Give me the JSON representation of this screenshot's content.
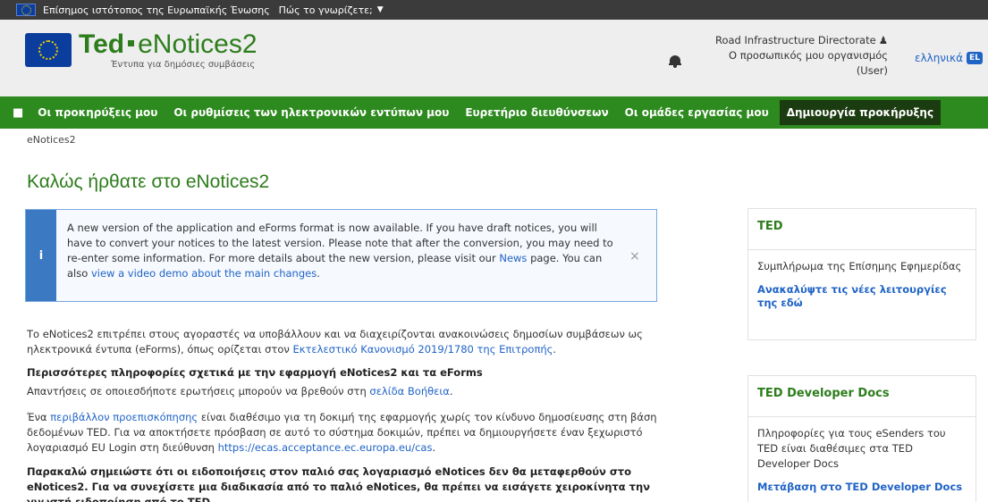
{
  "eu_bar": {
    "text": "Επίσημος ιστότοπος της Ευρωπαϊκής Ένωσης",
    "how_label": "Πώς το γνωρίζετε;"
  },
  "header": {
    "logo_ted": "Ted",
    "logo_enotices": "eNotices2",
    "logo_subtitle": "Έντυπα για δημόσιες συμβάσεις",
    "user_name": "Road Infrastructure Directorate",
    "organisation": "Ο προσωπικός μου οργανισμός",
    "role": "(User)",
    "language_label": "ελληνικά",
    "language_code": "EL"
  },
  "nav": {
    "items": [
      "Οι προκηρύξεις μου",
      "Οι ρυθμίσεις των ηλεκτρονικών εντύπων μου",
      "Ευρετήριο διευθύνσεων",
      "Οι ομάδες εργασίας μου",
      "Δημιουργία προκήρυξης"
    ]
  },
  "breadcrumb": "eNotices2",
  "page_title": "Καλώς ήρθατε στο eNotices2",
  "alert": {
    "icon": "i",
    "text_before": "A new version of the application and eForms format is now available. If you have draft notices, you will have to convert your notices to the latest version. Please note that after the conversion, you may need to re-enter some information. For more details about the new version, please visit our ",
    "news_link": "News",
    "text_middle": " page. You can also ",
    "video_link": "view a video demo about the main changes",
    "text_after": ".",
    "close": "×"
  },
  "content": {
    "p1_text": "Το eNotices2 επιτρέπει στους αγοραστές να υποβάλλουν και να διαχειρίζονται ανακοινώσεις δημοσίων συμβάσεων ως ηλεκτρονικά έντυπα (eForms), όπως ορίζεται στον ",
    "p1_link": "Εκτελεστικό Κανονισμό 2019/1780 της Επιτροπής",
    "p1_end": ".",
    "h2": "Περισσότερες πληροφορίες σχετικά με την εφαρμογή eNotices2 και τα eForms",
    "p2_text": "Απαντήσεις σε οποιεσδήποτε ερωτήσεις μπορούν να βρεθούν στη ",
    "p2_link": "σελίδα Βοήθεια",
    "p2_end": ".",
    "p3_a": "Ένα ",
    "p3_link": "περιβάλλον προεπισκόπησης",
    "p3_b": " είναι διαθέσιμο για τη δοκιμή της εφαρμογής χωρίς τον κίνδυνο δημοσίευσης στη βάση δεδομένων TED. Για να αποκτήσετε πρόσβαση σε αυτό το σύστημα δοκιμών, πρέπει να δημιουργήσετε έναν ξεχωριστό λογαριασμό EU Login στη διεύθυνση ",
    "p3_url": "https://ecas.acceptance.ec.europa.eu/cas",
    "p3_end": ".",
    "p4": "Παρακαλώ σημειώστε ότι οι ειδοποιήσεις στον παλιό σας λογαριασμό eNotices δεν θα μεταφερθούν στο eNotices2. Για να συνεχίσετε μια διαδικασία από το παλιό eNotices, θα πρέπει να εισάγετε χειροκίνητα την γνωστή ειδοποίηση από το TED."
  },
  "sidebar": {
    "ted": {
      "title": "TED",
      "text": "Συμπλήρωμα της Επίσημης Εφημερίδας",
      "link": "Ανακαλύψτε τις νέες λειτουργίες της εδώ"
    },
    "dev_docs": {
      "title": "TED Developer Docs",
      "text": "Πληροφορίες για τους eSenders του TED είναι διαθέσιμες στα TED Developer Docs",
      "link": "Μετάβαση στο TED Developer Docs"
    }
  },
  "colors": {
    "nav_green": "#2d8a1e",
    "title_green": "#2d7d1c",
    "link_blue": "#1f63c6",
    "alert_blue": "#3b79c3"
  }
}
